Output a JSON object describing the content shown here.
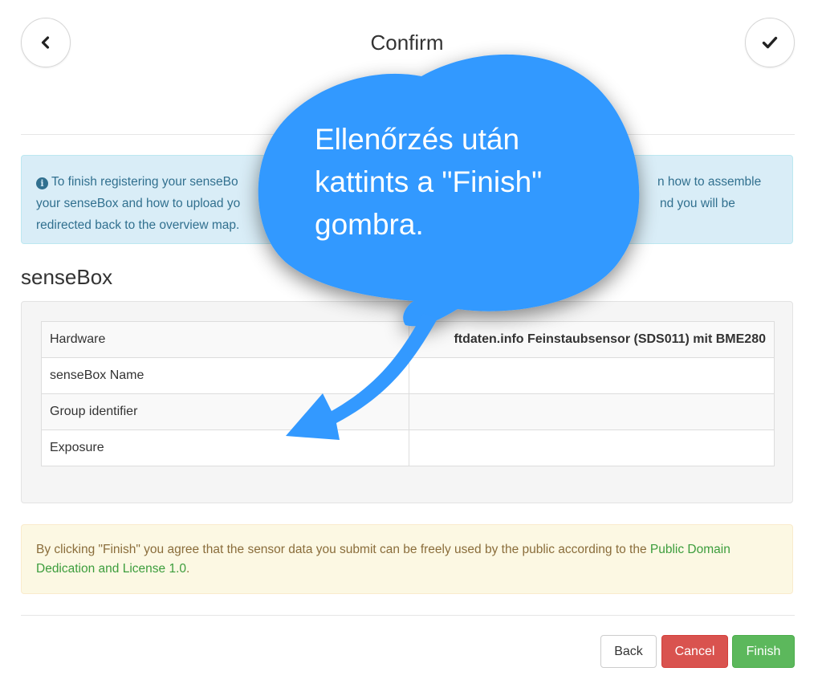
{
  "header": {
    "title": "Confirm",
    "back_icon": "chevron-left-icon",
    "confirm_icon": "checkmark-icon"
  },
  "info": {
    "icon": "info-circle-icon",
    "line1_start": "To finish registering your senseBo",
    "line1_end": "n how to assemble",
    "line2_start": "your senseBox and how to upload yo",
    "line2_end": "nd you will be",
    "line3": "redirected back to the overview map."
  },
  "section": {
    "title": "senseBox"
  },
  "table": {
    "rows": [
      {
        "label": "Hardware",
        "value": "ftdaten.info Feinstaubsensor (SDS011) mit BME280"
      },
      {
        "label": "senseBox Name",
        "value": ""
      },
      {
        "label": "Group identifier",
        "value": ""
      },
      {
        "label": "Exposure",
        "value": ""
      }
    ]
  },
  "agreement": {
    "text": "By clicking \"Finish\" you agree that the sensor data you submit can be freely used by the public according to the ",
    "link": "Public Domain Dedication and License 1.0",
    "end": "."
  },
  "buttons": {
    "back": "Back",
    "cancel": "Cancel",
    "finish": "Finish"
  },
  "callout": {
    "line1": "Ellenőrzés után",
    "line2": "kattints a \"Finish\"",
    "line3": "gombra."
  },
  "colors": {
    "callout": "#3399ff",
    "info_bg": "#d9edf7",
    "warning_bg": "#fcf8e3",
    "cancel": "#d9534f",
    "finish": "#5cb85c",
    "link": "#3c9d3c"
  }
}
